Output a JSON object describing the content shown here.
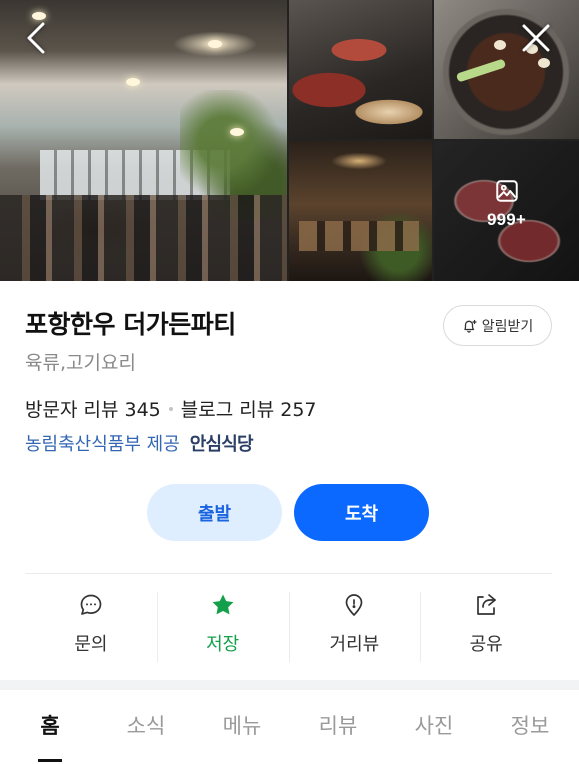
{
  "header": {
    "more_photos_count": "999+",
    "back_icon": "chevron-left-icon",
    "close_icon": "close-icon"
  },
  "place": {
    "name": "포항한우 더가든파티",
    "category": "육류,고기요리",
    "visitor_reviews": "방문자 리뷰 345",
    "blog_reviews": "블로그 리뷰 257",
    "provider": "농림축산식품부 제공",
    "badge": "안심식당"
  },
  "alarm": {
    "label": "알림받기",
    "icon": "bell-plus-icon"
  },
  "actions": {
    "depart": "출발",
    "arrive": "도착"
  },
  "quick_actions": [
    {
      "label": "문의",
      "icon": "chat-bubble-icon"
    },
    {
      "label": "저장",
      "icon": "star-icon"
    },
    {
      "label": "거리뷰",
      "icon": "map-pin-icon"
    },
    {
      "label": "공유",
      "icon": "share-icon"
    }
  ],
  "tabs": [
    "홈",
    "소식",
    "메뉴",
    "리뷰",
    "사진",
    "정보"
  ],
  "active_tab": "홈",
  "colors": {
    "primary": "#0b69ff",
    "primary_light": "#dfeeff",
    "saved_green": "#14a04a",
    "link_blue": "#3366b3"
  }
}
